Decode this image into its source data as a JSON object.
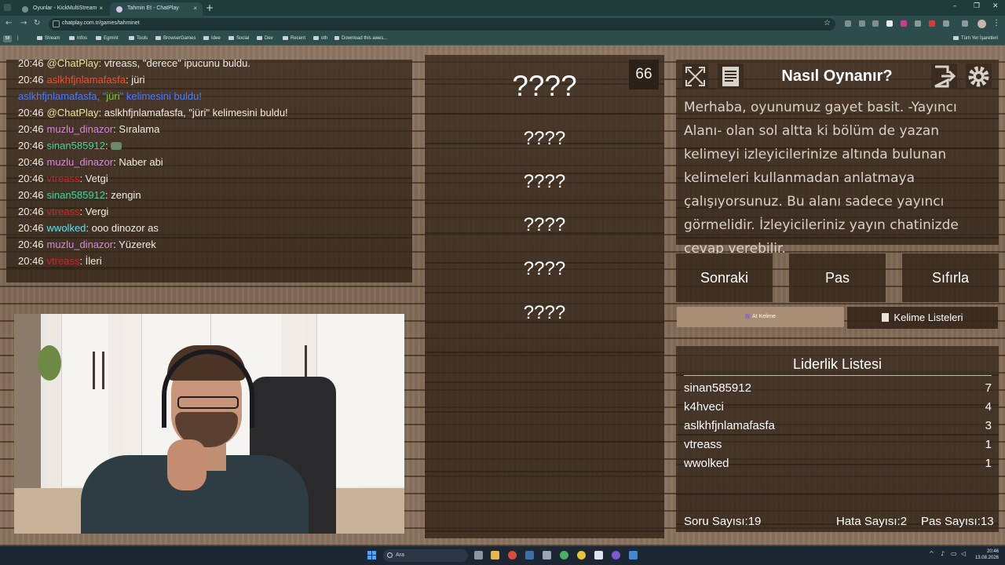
{
  "browser": {
    "tabs": [
      {
        "title": "Oyunlar - KickMultiStream"
      },
      {
        "title": "Tahmin Et - ChatPlay"
      }
    ],
    "url": "chatplay.com.tr/games/tahminet",
    "bookmarks": [
      "Stream",
      "Infos",
      "Egmint",
      "Tools",
      "BrowserGames",
      "Idee",
      "Social",
      "Dev",
      "Recent",
      "oth",
      "Download this awes..."
    ],
    "bookmarks_apps": "58",
    "all_bookmarks": "Tüm Yer İşaretleri"
  },
  "chat": {
    "messages": [
      {
        "time": "20:46",
        "user": "@ChatPlay",
        "user_color": "#e8e59a",
        "text": ": vtreass, \"derece\" ipucunu buldu."
      },
      {
        "time": "20:46",
        "user": "aslkhfjnlamafasfa",
        "user_color": "#ff4a2e",
        "text": ": jüri"
      },
      {
        "time": "",
        "user": "aslkhfjnlamafasfa, \"",
        "user_color": "#4a7cff",
        "text": "",
        "highlight": "jüri",
        "tail": "\" kelimesini buldu!"
      },
      {
        "time": "20:46",
        "user": "@ChatPlay",
        "user_color": "#e8e59a",
        "text": ": aslkhfjnlamafasfa, \"jüri\" kelimesini buldu!"
      },
      {
        "time": "20:46",
        "user": "muzlu_dinazor",
        "user_color": "#d48ad8",
        "text": ": Sıralama"
      },
      {
        "time": "20:46",
        "user": "sinan585912",
        "user_color": "#3ad6a0",
        "text": ":",
        "emote": true
      },
      {
        "time": "20:46",
        "user": "muzlu_dinazor",
        "user_color": "#d48ad8",
        "text": ": Naber abi"
      },
      {
        "time": "20:46",
        "user": "vtreass",
        "user_color": "#d3202a",
        "text": ": Vetgi"
      },
      {
        "time": "20:46",
        "user": "sinan585912",
        "user_color": "#3ad6a0",
        "text": ": zengin"
      },
      {
        "time": "20:46",
        "user": "vtreass",
        "user_color": "#d3202a",
        "text": ": Vergi"
      },
      {
        "time": "20:46",
        "user": "wwolked",
        "user_color": "#57e3f5",
        "text": ": ooo dinozor as"
      },
      {
        "time": "20:46",
        "user": "muzlu_dinazor",
        "user_color": "#d48ad8",
        "text": ": Yüzerek"
      },
      {
        "time": "20:46",
        "user": "vtreass",
        "user_color": "#d3202a",
        "text": ": İleri"
      }
    ]
  },
  "game": {
    "counter": "66",
    "main_word": "????",
    "forbidden_words": [
      "????",
      "????",
      "????",
      "????",
      "????"
    ]
  },
  "how_to": {
    "title": "Nasıl Oynanır?",
    "body": "Merhaba, oyunumuz gayet basit. -Yayıncı Alanı- olan sol altta ki bölüm de yazan kelimeyi izleyicilerinize altında bulunan kelimeleri kullanmadan anlatmaya çalışıyorsunuz. Bu alanı sadece yayıncı görmelidir. İzleyicileriniz yayın chatinizde cevap verebilir."
  },
  "controls": {
    "next": "Sonraki",
    "pass": "Pas",
    "reset": "Sıfırla",
    "ai_word": "AI Kelime",
    "word_lists": "Kelime Listeleri"
  },
  "leaderboard": {
    "title": "Liderlik Listesi",
    "rows": [
      {
        "name": "sinan585912",
        "score": "7"
      },
      {
        "name": "k4hveci",
        "score": "4"
      },
      {
        "name": "aslkhfjnlamafasfa",
        "score": "3"
      },
      {
        "name": "vtreass",
        "score": "1"
      },
      {
        "name": "wwolked",
        "score": "1"
      }
    ],
    "question_label": "Soru Sayısı:",
    "question_count": "19",
    "error_label": "Hata Sayısı:",
    "error_count": "2",
    "pass_label": "Pas Sayısı:",
    "pass_count": "13"
  },
  "taskbar": {
    "search_placeholder": "Ara",
    "time": "20:46",
    "date": "13.08.2026"
  },
  "icons": [
    "fullscreen-icon",
    "notes-icon",
    "exit-icon",
    "settings-icon",
    "search-icon",
    "windows-start-icon"
  ]
}
